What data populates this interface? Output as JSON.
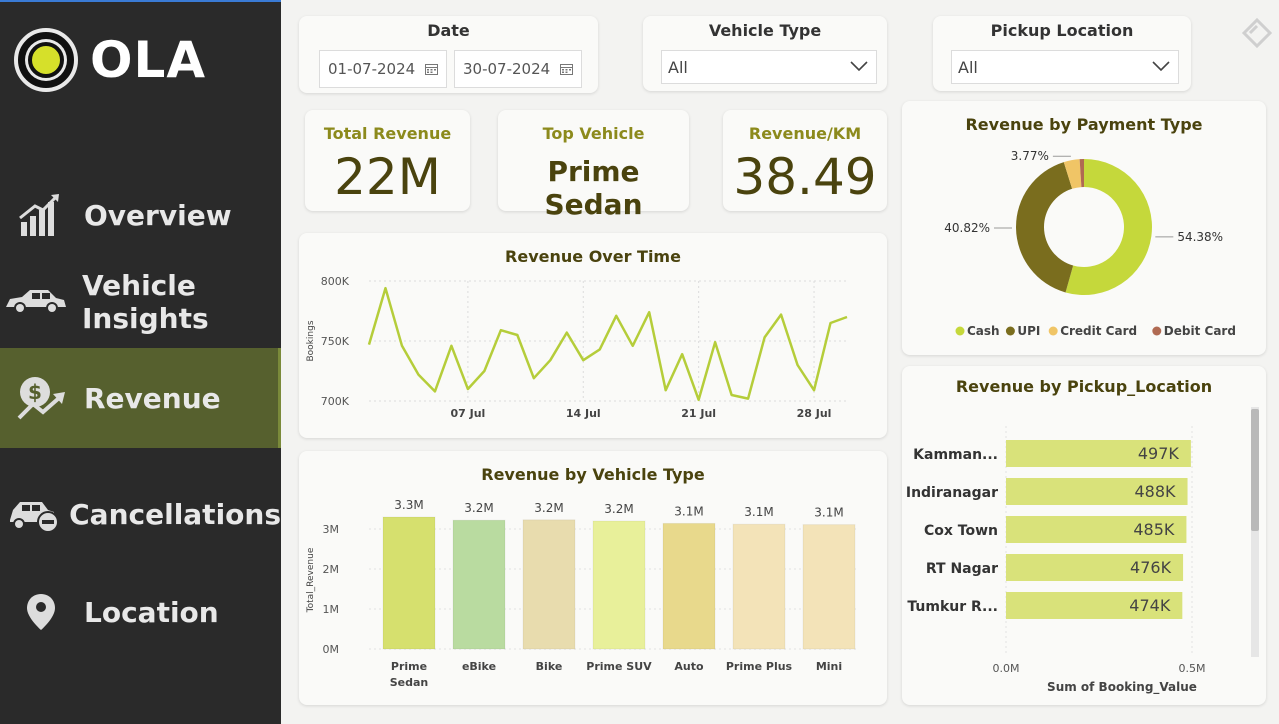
{
  "brand": {
    "name": "OLA"
  },
  "nav": [
    {
      "label": "Overview",
      "icon": "growth-chart-icon",
      "active": false
    },
    {
      "label": "Vehicle Insights",
      "icon": "car-icon",
      "active": false
    },
    {
      "label": "Revenue",
      "icon": "money-growth-icon",
      "active": true
    },
    {
      "label": "Cancellations",
      "icon": "car-cancel-icon",
      "active": false
    },
    {
      "label": "Location",
      "icon": "location-pin-icon",
      "active": false
    }
  ],
  "filters": {
    "date": {
      "title": "Date",
      "start": "01-07-2024",
      "end": "30-07-2024"
    },
    "vehicle_type": {
      "title": "Vehicle Type",
      "value": "All"
    },
    "pickup_location": {
      "title": "Pickup Location",
      "value": "All"
    }
  },
  "kpis": {
    "total_revenue": {
      "label": "Total Revenue",
      "value": "22M"
    },
    "top_vehicle": {
      "label": "Top Vehicle",
      "value": "Prime Sedan"
    },
    "revenue_per_km": {
      "label": "Revenue/KM",
      "value": "38.49"
    }
  },
  "colors": {
    "sidebar": "#2a2a2a",
    "active_nav": "#56602e",
    "line": "#b5cd3a",
    "title": "#4a430e",
    "kpi_label": "#8c8a1c"
  },
  "chart_data": [
    {
      "type": "line",
      "title": "Revenue Over Time",
      "ylabel": "Bookings",
      "xlabel": "",
      "x_tick_labels": [
        "07 Jul",
        "14 Jul",
        "21 Jul",
        "28 Jul"
      ],
      "x_tick_days": [
        7,
        14,
        21,
        28
      ],
      "y_tick_labels": [
        "800K",
        "750K",
        "700K"
      ],
      "y_ticks": [
        800000,
        750000,
        700000
      ],
      "ylim": [
        700000,
        800000
      ],
      "xlim": [
        1,
        30
      ],
      "x": [
        1,
        2,
        3,
        4,
        5,
        6,
        7,
        8,
        9,
        10,
        11,
        12,
        13,
        14,
        15,
        16,
        17,
        18,
        19,
        20,
        21,
        22,
        23,
        24,
        25,
        26,
        27,
        28,
        29,
        30
      ],
      "values": [
        747000,
        794000,
        746000,
        722000,
        708000,
        746000,
        710000,
        725000,
        759000,
        755000,
        719000,
        734000,
        757000,
        734000,
        743000,
        771000,
        746000,
        774000,
        709000,
        739000,
        701000,
        749000,
        705000,
        702000,
        753000,
        772000,
        730000,
        709000,
        765000,
        770000
      ],
      "grid": true
    },
    {
      "type": "donut",
      "title": "Revenue by Payment Type",
      "categories": [
        "Cash",
        "UPI",
        "Credit Card",
        "Debit Card"
      ],
      "values": [
        54.38,
        40.82,
        3.77,
        1.03
      ],
      "labels": [
        "54.38%",
        "40.82%",
        "3.77%",
        ""
      ],
      "colors": [
        "#c5d83b",
        "#7a6d1e",
        "#f0c566",
        "#b06a52"
      ],
      "legend": "bottom"
    },
    {
      "type": "bar",
      "title": "Revenue by Vehicle Type",
      "ylabel": "Total_Revenue",
      "xlabel": "",
      "categories": [
        "Prime Sedan",
        "eBike",
        "Bike",
        "Prime SUV",
        "Auto",
        "Prime Plus",
        "Mini"
      ],
      "category_lines": [
        [
          "Prime",
          "Sedan"
        ],
        [
          "eBike"
        ],
        [
          "Bike"
        ],
        [
          "Prime SUV"
        ],
        [
          "Auto"
        ],
        [
          "Prime Plus"
        ],
        [
          "Mini"
        ]
      ],
      "values": [
        3.3,
        3.22,
        3.23,
        3.2,
        3.14,
        3.12,
        3.11
      ],
      "data_labels": [
        "3.3M",
        "3.2M",
        "3.2M",
        "3.2M",
        "3.1M",
        "3.1M",
        "3.1M"
      ],
      "colors": [
        "#d6e06e",
        "#b9dba0",
        "#e8dcae",
        "#e8f09a",
        "#e8d98c",
        "#f3e3b8",
        "#f3e3b8"
      ],
      "y_tick_labels": [
        "3M",
        "2M",
        "1M",
        "0M"
      ],
      "y_ticks": [
        3,
        2,
        1,
        0
      ],
      "ylim": [
        0,
        3.45
      ],
      "grid": true
    },
    {
      "type": "bar",
      "orientation": "horizontal",
      "title": "Revenue by Pickup_Location",
      "xlabel": "Sum of Booking_Value",
      "categories": [
        "Kamman...",
        "Indiranagar",
        "Cox Town",
        "RT Nagar",
        "Tumkur R..."
      ],
      "values": [
        497000,
        488000,
        485000,
        476000,
        474000
      ],
      "data_labels": [
        "497K",
        "488K",
        "485K",
        "476K",
        "474K"
      ],
      "x_tick_labels": [
        "0.0M",
        "0.5M"
      ],
      "x_ticks": [
        0,
        500000
      ],
      "xlim": [
        0,
        500000
      ],
      "color": "#d9e27a"
    }
  ]
}
